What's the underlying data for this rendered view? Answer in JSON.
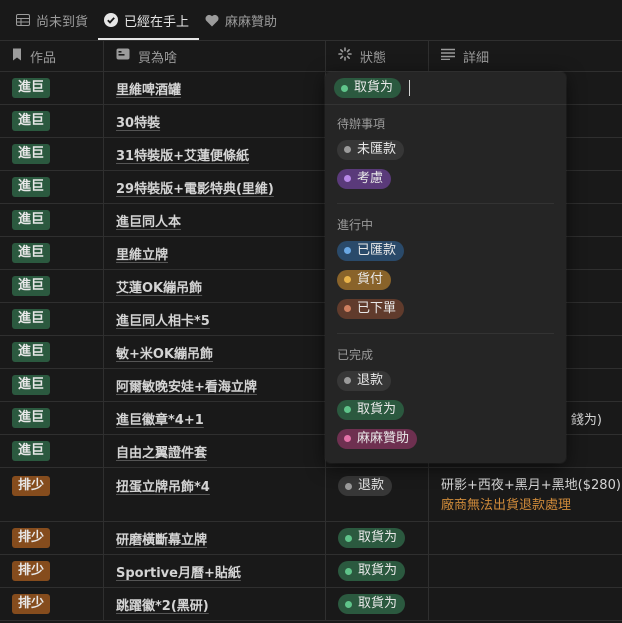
{
  "tabs": [
    {
      "label": "尚未到貨",
      "icon": "table-icon"
    },
    {
      "label": "已經在手上",
      "icon": "check-circle-icon"
    },
    {
      "label": "麻麻贊助",
      "icon": "heart-icon"
    }
  ],
  "columns": {
    "work": "作品",
    "item": "買為啥",
    "status": "狀態",
    "detail": "詳細"
  },
  "rows": [
    {
      "work": "進巨",
      "work_color": "green",
      "item": "里維啤酒罐"
    },
    {
      "work": "進巨",
      "work_color": "green",
      "item": "30特裝"
    },
    {
      "work": "進巨",
      "work_color": "green",
      "item": "31特裝版+艾蓮便條紙"
    },
    {
      "work": "進巨",
      "work_color": "green",
      "item": "29特裝版+電影特典(里維)"
    },
    {
      "work": "進巨",
      "work_color": "green",
      "item": "進巨同人本"
    },
    {
      "work": "進巨",
      "work_color": "green",
      "item": "里維立牌"
    },
    {
      "work": "進巨",
      "work_color": "green",
      "item": "艾蓮OK繃吊飾"
    },
    {
      "work": "進巨",
      "work_color": "green",
      "item": "進巨同人相卡*5"
    },
    {
      "work": "進巨",
      "work_color": "green",
      "item": "敏+米OK繃吊飾"
    },
    {
      "work": "進巨",
      "work_color": "green",
      "item": "阿爾敏晚安娃+看海立牌"
    },
    {
      "work": "進巨",
      "work_color": "green",
      "item": "進巨徽章*4+1",
      "detail_visible": "錢为)"
    },
    {
      "work": "進巨",
      "work_color": "green",
      "item": "自由之翼證件套"
    },
    {
      "work": "排少",
      "work_color": "orange",
      "item": "扭蛋立牌吊飾*4",
      "status": "退款",
      "status_color": "gray",
      "detail": "研影+西夜+黑月+黑地($280)",
      "detail_note": "廠商無法出貨退款處理"
    },
    {
      "work": "排少",
      "work_color": "orange",
      "item": "研磨橫斷幕立牌",
      "status": "取貨为",
      "status_color": "green"
    },
    {
      "work": "排少",
      "work_color": "orange",
      "item": "Sportive月曆+貼紙",
      "status": "取貨为",
      "status_color": "green"
    },
    {
      "work": "排少",
      "work_color": "orange",
      "item": "跳躍徽*2(黑研)",
      "status": "取貨为",
      "status_color": "green"
    }
  ],
  "dropdown": {
    "selected": "取貨为",
    "groups": [
      {
        "label": "待辦事項",
        "options": [
          {
            "label": "未匯款",
            "color": "gray"
          },
          {
            "label": "考慮",
            "color": "purple"
          }
        ]
      },
      {
        "label": "進行中",
        "options": [
          {
            "label": "已匯款",
            "color": "blue"
          },
          {
            "label": "貨付",
            "color": "yellow"
          },
          {
            "label": "已下單",
            "color": "brown"
          }
        ]
      },
      {
        "label": "已完成",
        "options": [
          {
            "label": "退款",
            "color": "gray"
          },
          {
            "label": "取貨为",
            "color": "green"
          },
          {
            "label": "麻麻贊助",
            "color": "pink"
          }
        ]
      }
    ]
  }
}
